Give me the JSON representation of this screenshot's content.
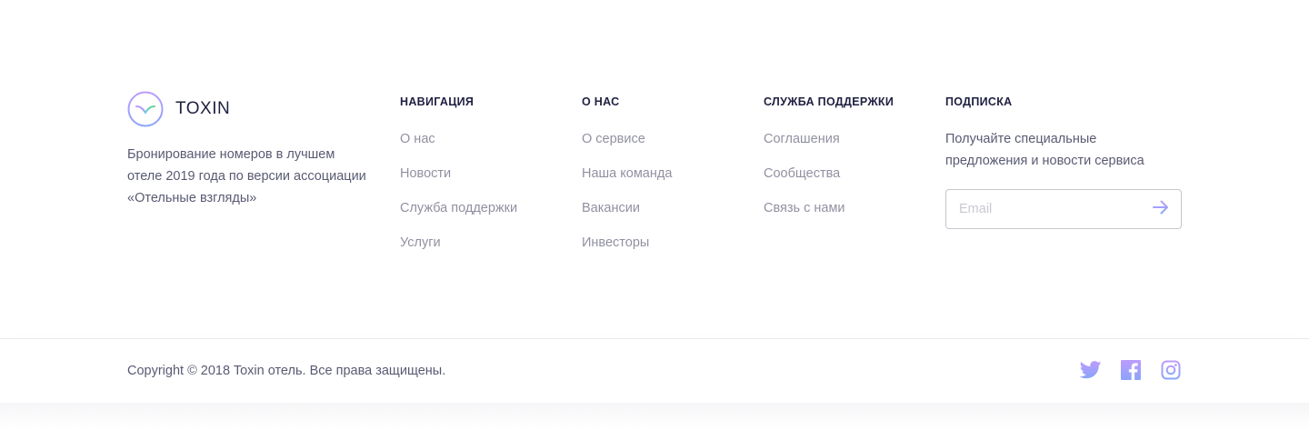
{
  "brand": {
    "name": "TOXIN",
    "description": "Бронирование номеров в лучшем отеле 2019 года по версии ассоциации «Отельные взгляды»"
  },
  "columns": [
    {
      "title": "НАВИГАЦИЯ",
      "links": [
        "О нас",
        "Новости",
        "Служба поддержки",
        "Услуги"
      ]
    },
    {
      "title": "О НАС",
      "links": [
        "О сервисе",
        "Наша команда",
        "Вакансии",
        "Инвесторы"
      ]
    },
    {
      "title": "СЛУЖБА ПОДДЕРЖКИ",
      "links": [
        "Соглашения",
        "Сообщества",
        "Связь с нами"
      ]
    }
  ],
  "subscribe": {
    "title": "ПОДПИСКА",
    "description": "Получайте специальные предложения и новости сервиса",
    "input_placeholder": "Email",
    "input_value": ""
  },
  "bottom": {
    "copyright": "Copyright © 2018 Toxin отель. Все права защищены."
  },
  "socials": [
    {
      "icon": "twitter-icon"
    },
    {
      "icon": "facebook-icon"
    },
    {
      "icon": "instagram-icon"
    }
  ],
  "colors": {
    "accent_gradient_start": "#BC9CFF",
    "accent_gradient_end": "#8BA4F9",
    "logo_green_start": "#6FCF97",
    "logo_green_end": "#66D2EA",
    "dark": "#1F2041"
  }
}
